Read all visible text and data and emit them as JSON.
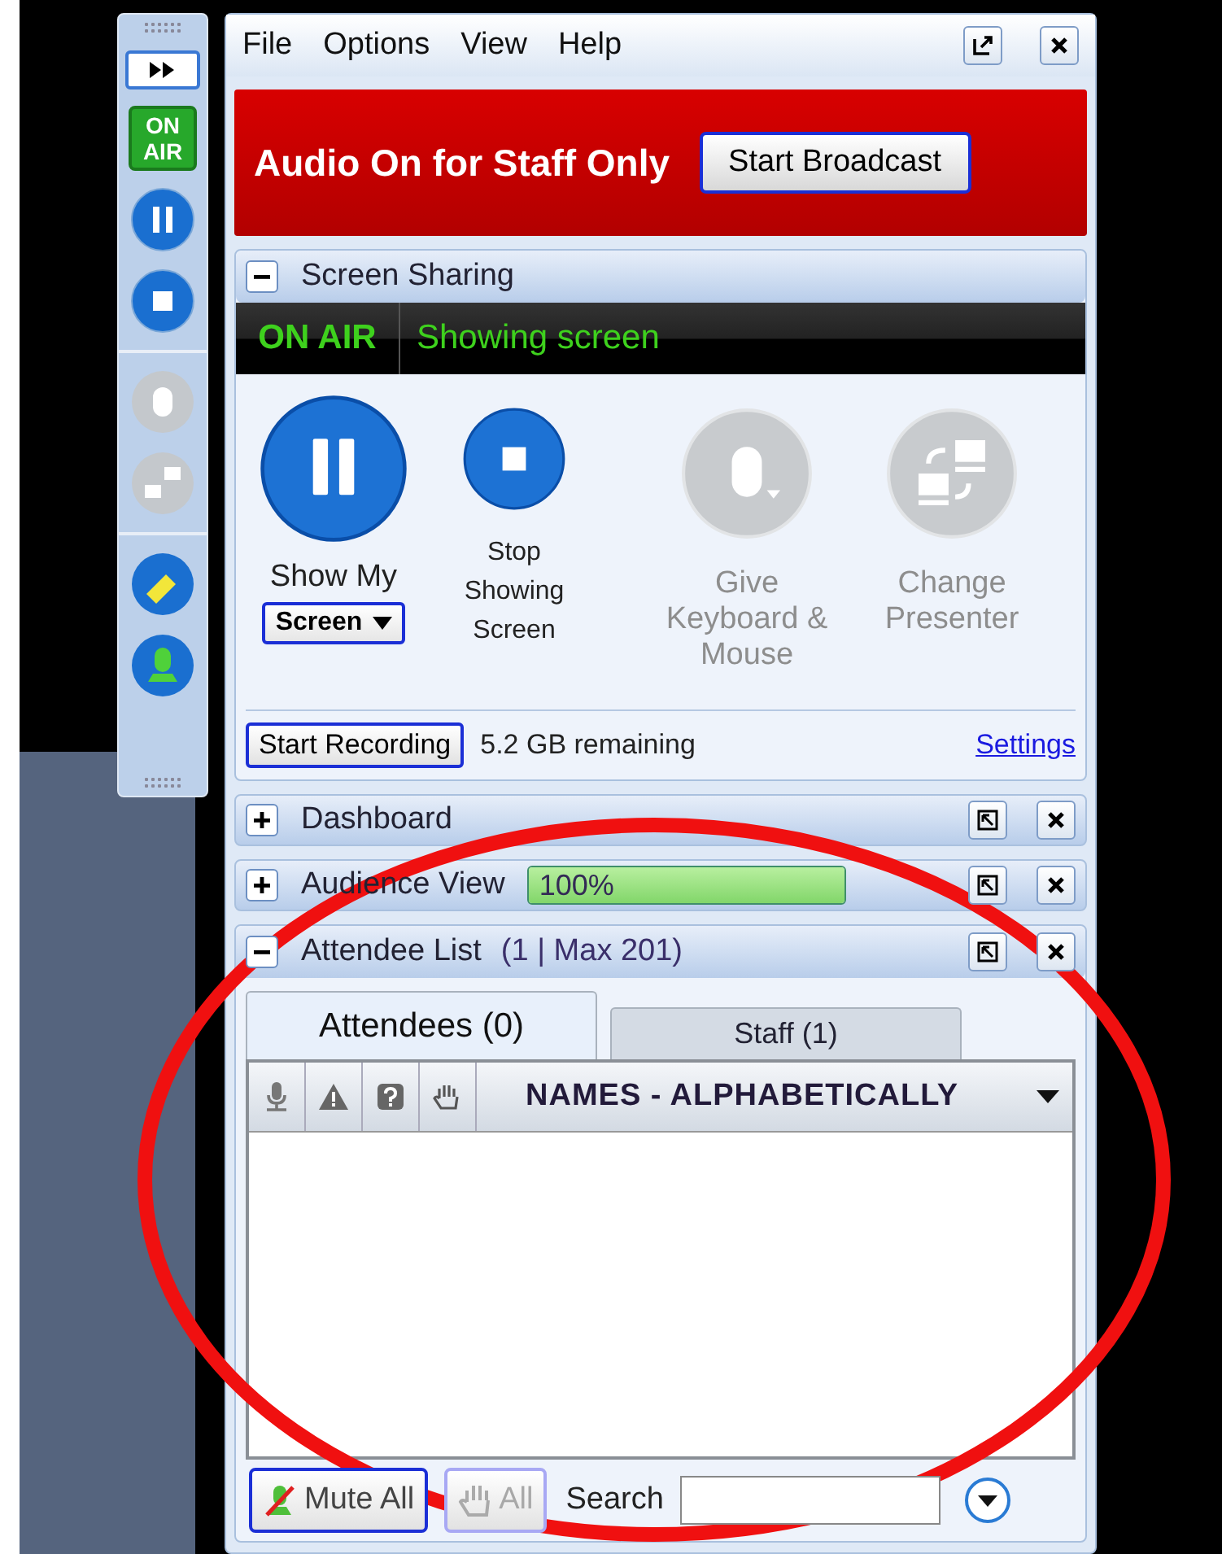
{
  "toolbar": {
    "on_air_badge": "ON AIR"
  },
  "menu": [
    "File",
    "Options",
    "View",
    "Help"
  ],
  "audio_banner": {
    "message": "Audio On for Staff Only",
    "button": "Start Broadcast"
  },
  "screen_sharing": {
    "title": "Screen Sharing",
    "expanded": true,
    "status_badge": "ON AIR",
    "status_text": "Showing screen",
    "actions": [
      {
        "kind": "pause",
        "label": "Show My",
        "dropdown": "Screen",
        "disabled": false
      },
      {
        "kind": "stop",
        "label": "Stop Showing Screen",
        "disabled": false
      },
      {
        "kind": "mouse",
        "label": "Give Keyboard & Mouse",
        "disabled": true
      },
      {
        "kind": "presenter",
        "label": "Change Presenter",
        "disabled": true
      }
    ],
    "record_button": "Start Recording",
    "storage": "5.2 GB remaining",
    "settings_link": "Settings"
  },
  "panels": [
    {
      "title": "Dashboard",
      "expanded": false
    },
    {
      "title": "Audience View",
      "expanded": false,
      "meter": {
        "label": "100%",
        "level": 1
      }
    }
  ],
  "attendee_list": {
    "title": "Attendee List",
    "count": "(1 | Max 201)",
    "expanded": true,
    "tabs": [
      {
        "label": "Attendees (0)",
        "selected": true
      },
      {
        "label": "Staff (1)",
        "selected": false
      }
    ],
    "sort_label": "NAMES - ALPHABETICALLY",
    "mute_button": "Mute All",
    "hands_button": "All",
    "hands_disabled": true,
    "search_label": "Search"
  }
}
